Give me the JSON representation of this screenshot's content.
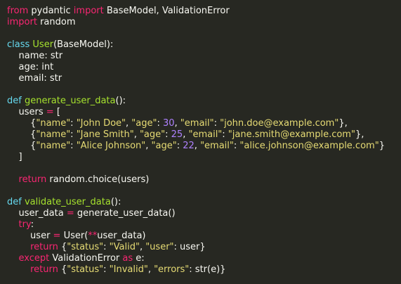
{
  "editor": {
    "background": "#272822",
    "colors": {
      "keyword": "#f92672",
      "definition": "#66d9ef",
      "function": "#a6e22e",
      "string": "#e6db74",
      "number": "#ae81ff",
      "text": "#f8f8f2"
    },
    "lines": [
      [
        [
          "kw",
          "from"
        ],
        [
          "plain",
          " pydantic "
        ],
        [
          "kw",
          "import"
        ],
        [
          "plain",
          " BaseModel, ValidationError"
        ]
      ],
      [
        [
          "kw",
          "import"
        ],
        [
          "plain",
          " random"
        ]
      ],
      [],
      [
        [
          "def",
          "class"
        ],
        [
          "plain",
          " "
        ],
        [
          "fn",
          "User"
        ],
        [
          "plain",
          "(BaseModel):"
        ]
      ],
      [
        [
          "plain",
          "    name: str"
        ]
      ],
      [
        [
          "plain",
          "    age: int"
        ]
      ],
      [
        [
          "plain",
          "    email: str"
        ]
      ],
      [],
      [
        [
          "def",
          "def"
        ],
        [
          "plain",
          " "
        ],
        [
          "fn",
          "generate_user_data"
        ],
        [
          "plain",
          "():"
        ]
      ],
      [
        [
          "plain",
          "    users "
        ],
        [
          "op",
          "="
        ],
        [
          "plain",
          " ["
        ]
      ],
      [
        [
          "plain",
          "        {"
        ],
        [
          "str",
          "\"name\""
        ],
        [
          "plain",
          ": "
        ],
        [
          "str",
          "\"John Doe\""
        ],
        [
          "plain",
          ", "
        ],
        [
          "str",
          "\"age\""
        ],
        [
          "plain",
          ": "
        ],
        [
          "num",
          "30"
        ],
        [
          "plain",
          ", "
        ],
        [
          "str",
          "\"email\""
        ],
        [
          "plain",
          ": "
        ],
        [
          "str",
          "\"john.doe@example.com\""
        ],
        [
          "plain",
          "},"
        ]
      ],
      [
        [
          "plain",
          "        {"
        ],
        [
          "str",
          "\"name\""
        ],
        [
          "plain",
          ": "
        ],
        [
          "str",
          "\"Jane Smith\""
        ],
        [
          "plain",
          ", "
        ],
        [
          "str",
          "\"age\""
        ],
        [
          "plain",
          ": "
        ],
        [
          "num",
          "25"
        ],
        [
          "plain",
          ", "
        ],
        [
          "str",
          "\"email\""
        ],
        [
          "plain",
          ": "
        ],
        [
          "str",
          "\"jane.smith@example.com\""
        ],
        [
          "plain",
          "},"
        ]
      ],
      [
        [
          "plain",
          "        {"
        ],
        [
          "str",
          "\"name\""
        ],
        [
          "plain",
          ": "
        ],
        [
          "str",
          "\"Alice Johnson\""
        ],
        [
          "plain",
          ", "
        ],
        [
          "str",
          "\"age\""
        ],
        [
          "plain",
          ": "
        ],
        [
          "num",
          "22"
        ],
        [
          "plain",
          ", "
        ],
        [
          "str",
          "\"email\""
        ],
        [
          "plain",
          ": "
        ],
        [
          "str",
          "\"alice.johnson@example.com\""
        ],
        [
          "plain",
          "}"
        ]
      ],
      [
        [
          "plain",
          "    ]"
        ]
      ],
      [],
      [
        [
          "plain",
          "    "
        ],
        [
          "kw",
          "return"
        ],
        [
          "plain",
          " random.choice(users)"
        ]
      ],
      [],
      [
        [
          "def",
          "def"
        ],
        [
          "plain",
          " "
        ],
        [
          "fn",
          "validate_user_data"
        ],
        [
          "plain",
          "():"
        ]
      ],
      [
        [
          "plain",
          "    user_data "
        ],
        [
          "op",
          "="
        ],
        [
          "plain",
          " generate_user_data()"
        ]
      ],
      [
        [
          "plain",
          "    "
        ],
        [
          "kw",
          "try"
        ],
        [
          "plain",
          ":"
        ]
      ],
      [
        [
          "plain",
          "        user "
        ],
        [
          "op",
          "="
        ],
        [
          "plain",
          " User("
        ],
        [
          "op",
          "**"
        ],
        [
          "plain",
          "user_data)"
        ]
      ],
      [
        [
          "plain",
          "        "
        ],
        [
          "kw",
          "return"
        ],
        [
          "plain",
          " {"
        ],
        [
          "str",
          "\"status\""
        ],
        [
          "plain",
          ": "
        ],
        [
          "str",
          "\"Valid\""
        ],
        [
          "plain",
          ", "
        ],
        [
          "str",
          "\"user\""
        ],
        [
          "plain",
          ": user}"
        ]
      ],
      [
        [
          "plain",
          "    "
        ],
        [
          "kw",
          "except"
        ],
        [
          "plain",
          " ValidationError "
        ],
        [
          "kw",
          "as"
        ],
        [
          "plain",
          " e:"
        ]
      ],
      [
        [
          "plain",
          "        "
        ],
        [
          "kw",
          "return"
        ],
        [
          "plain",
          " {"
        ],
        [
          "str",
          "\"status\""
        ],
        [
          "plain",
          ": "
        ],
        [
          "str",
          "\"Invalid\""
        ],
        [
          "plain",
          ", "
        ],
        [
          "str",
          "\"errors\""
        ],
        [
          "plain",
          ": str(e)}"
        ]
      ]
    ]
  }
}
